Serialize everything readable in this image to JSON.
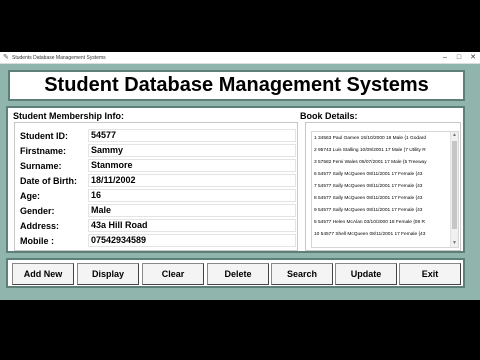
{
  "window": {
    "title": "Students Database Management Systems",
    "controls": {
      "minimize": "–",
      "maximize": "□",
      "close": "✕"
    }
  },
  "header": {
    "title": "Student Database Management Systems"
  },
  "membership": {
    "section_title": "Student Membership Info:",
    "fields": [
      {
        "label": "Student ID:",
        "value": "54577"
      },
      {
        "label": "Firstname:",
        "value": "Sammy"
      },
      {
        "label": "Surname:",
        "value": "Stanmore"
      },
      {
        "label": "Date of Birth:",
        "value": "18/11/2002"
      },
      {
        "label": "Age:",
        "value": "16"
      },
      {
        "label": "Gender:",
        "value": "Male"
      },
      {
        "label": "Address:",
        "value": "43a Hill Road"
      },
      {
        "label": "Mobile :",
        "value": "07542934589"
      }
    ]
  },
  "books": {
    "section_title": "Book Details:",
    "items": [
      "1 34563 Paul Oamen 15/10/2000 18 Male {1 Godard",
      "2 95743 Luis Stalling 10/09/2001 17 Male {7 Utility R",
      "3 57582 Femi Wales 05/07/2001 17 Male {5 Treeway",
      "6 54577 Sally McQueen 08/11/2001 17 Female {43",
      "7 54577 Sally McQueen 08/11/2001 17 Female {43",
      "8 54577 Sally McQueen 08/11/2001 17 Female {43",
      "9 54577 Sally McQueen 08/11/2001 17 Female {43",
      "5 54577 Helen McAlan 03/10/2000 18 Female {08 R",
      "10 54577 Shell McQueen 08/11/2001 17 Female {43"
    ]
  },
  "buttons": {
    "add_new": "Add New",
    "display": "Display",
    "clear": "Clear",
    "delete": "Delete",
    "search": "Search",
    "update": "Update",
    "exit": "Exit"
  },
  "colors": {
    "background": "#8fb5ad",
    "frame_border": "#5e7f78",
    "panel": "#ffffff"
  }
}
